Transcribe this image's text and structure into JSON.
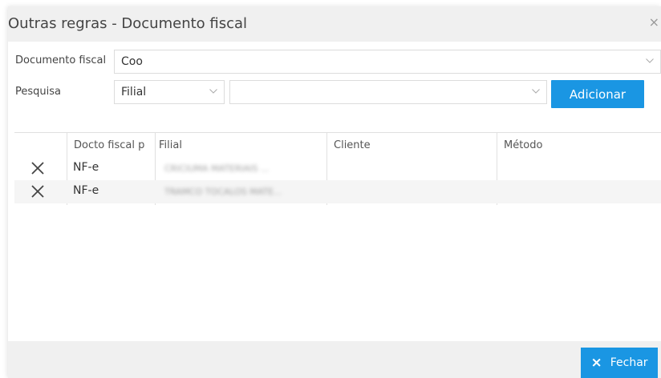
{
  "dialog": {
    "title": "Outras regras - Documento fiscal",
    "close_glyph": "×"
  },
  "form": {
    "documento_label": "Documento fiscal",
    "documento_value": "Coo",
    "pesquisa_label": "Pesquisa",
    "pesquisa_type_value": "Filial",
    "pesquisa_search_value": "",
    "add_button_label": "Adicionar"
  },
  "grid": {
    "columns": [
      "Docto fiscal p",
      "Filial",
      "Cliente",
      "Método"
    ],
    "rows": [
      {
        "docto": "NF-e",
        "filial": "CRICIUMA MATERIAIS ...",
        "cliente": "",
        "metodo": ""
      },
      {
        "docto": "NF-e",
        "filial": "TRAMCO TOCALOS MATE...",
        "cliente": "",
        "metodo": ""
      }
    ]
  },
  "footer": {
    "close_label": "Fechar",
    "close_icon": "×"
  },
  "colors": {
    "accent": "#1a96e3",
    "header_bg": "#f0f0f0"
  }
}
